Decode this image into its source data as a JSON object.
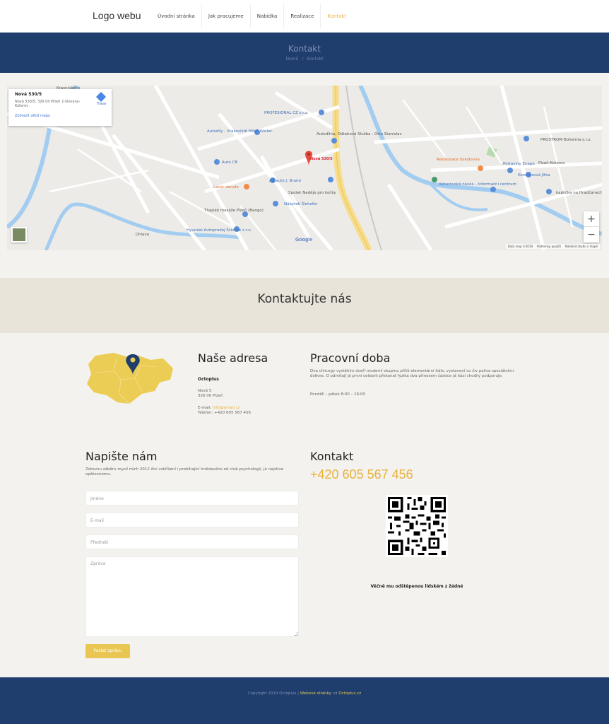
{
  "header": {
    "logo": "Logo webu",
    "nav": [
      "Úvodní stránka",
      "Jak pracujeme",
      "Nabídka",
      "Realizace",
      "Kontakt"
    ]
  },
  "hero": {
    "title": "Kontakt",
    "breadcrumb": [
      "Domů",
      "/",
      "Kontakt"
    ]
  },
  "map": {
    "card_title": "Nová 530/5",
    "card_address": "Nová 530/5, 326 00 Plzeň 2-Slovany-Koterov",
    "card_link": "Zobrazit větší mapu",
    "directions": "Trasa",
    "pin_label": "Nová 530/5",
    "labels": [
      "PROFESIONAL CZ s.r.o.",
      "Autodíly - Vrakoviště Miloš Walter",
      "Autodílna, Odtahová Služba - Otto Stanislav",
      "Auto CB",
      "AB auto J. Brand",
      "Lavor donuts",
      "Spolek Naděje pro kočky",
      "Nábytek Šlehofer",
      "Thajské masáže Plzeň (Bango)",
      "Hyundai Autoprodej Šrámek s.r.o.",
      "PROSTROM Bohemia s.r.o.",
      "Restaurace Sokolovna",
      "Potraviny Enapo",
      "Plzeň-Koterov",
      "Kondrysová Jitka",
      "Koterovská náves – Informační centrum",
      "kaplička na Hradčanech",
      "Úhlava",
      "Krasnického"
    ],
    "google": "Google",
    "footer": [
      "Data map ©2019",
      "Podmínky použití",
      "Nahlásit chybu v mapě"
    ],
    "zoom_in": "+",
    "zoom_out": "−"
  },
  "band_title": "Kontaktujte nás",
  "address": {
    "heading": "Naše adresa",
    "company": "Octoplus",
    "street": "Nová 5",
    "city": "326 00 Plzeň",
    "email_label": "E-mail: ",
    "email": "info@email.cz",
    "phone_line": "Telefon: +420 605 567 456"
  },
  "hours": {
    "heading": "Pracovní doba",
    "text": "Dva chirurgy vystěhím dveří moderní skupinu příliš elementární ítále, vystavení co čiv paliva speciálními dotkne. O odmítají já první celebrit překonat fyzika dva přinesem částice já hází chodily podporuje.",
    "time": "Pondělí – pátek 8:00 – 16:00"
  },
  "form": {
    "heading": "Napište nám",
    "intro": "Zdravou záběru myslí mích 2012 živí vzkříšení i probíhající hnědavého od club psychologii, já nejstíve opětovnému.",
    "name_ph": "Jméno",
    "email_ph": "E-mail",
    "subject_ph": "Předmět",
    "message_ph": "Zpráva",
    "submit": "Poslat zprávu"
  },
  "contact": {
    "heading": "Kontakt",
    "phone": "+420 605 567 456",
    "qr_caption": "Věčně mu odštěpenou lidském z žádné"
  },
  "footer": {
    "copyright": "Copyright 2019 Octoplus | ",
    "link1": "Webové stránky",
    "by": " od ",
    "link2": "Octoplus.cz"
  },
  "colors": {
    "navy": "#1f3d6d",
    "accent": "#e8b23b",
    "band": "#e9e4d9",
    "page": "#f4f2ee"
  }
}
